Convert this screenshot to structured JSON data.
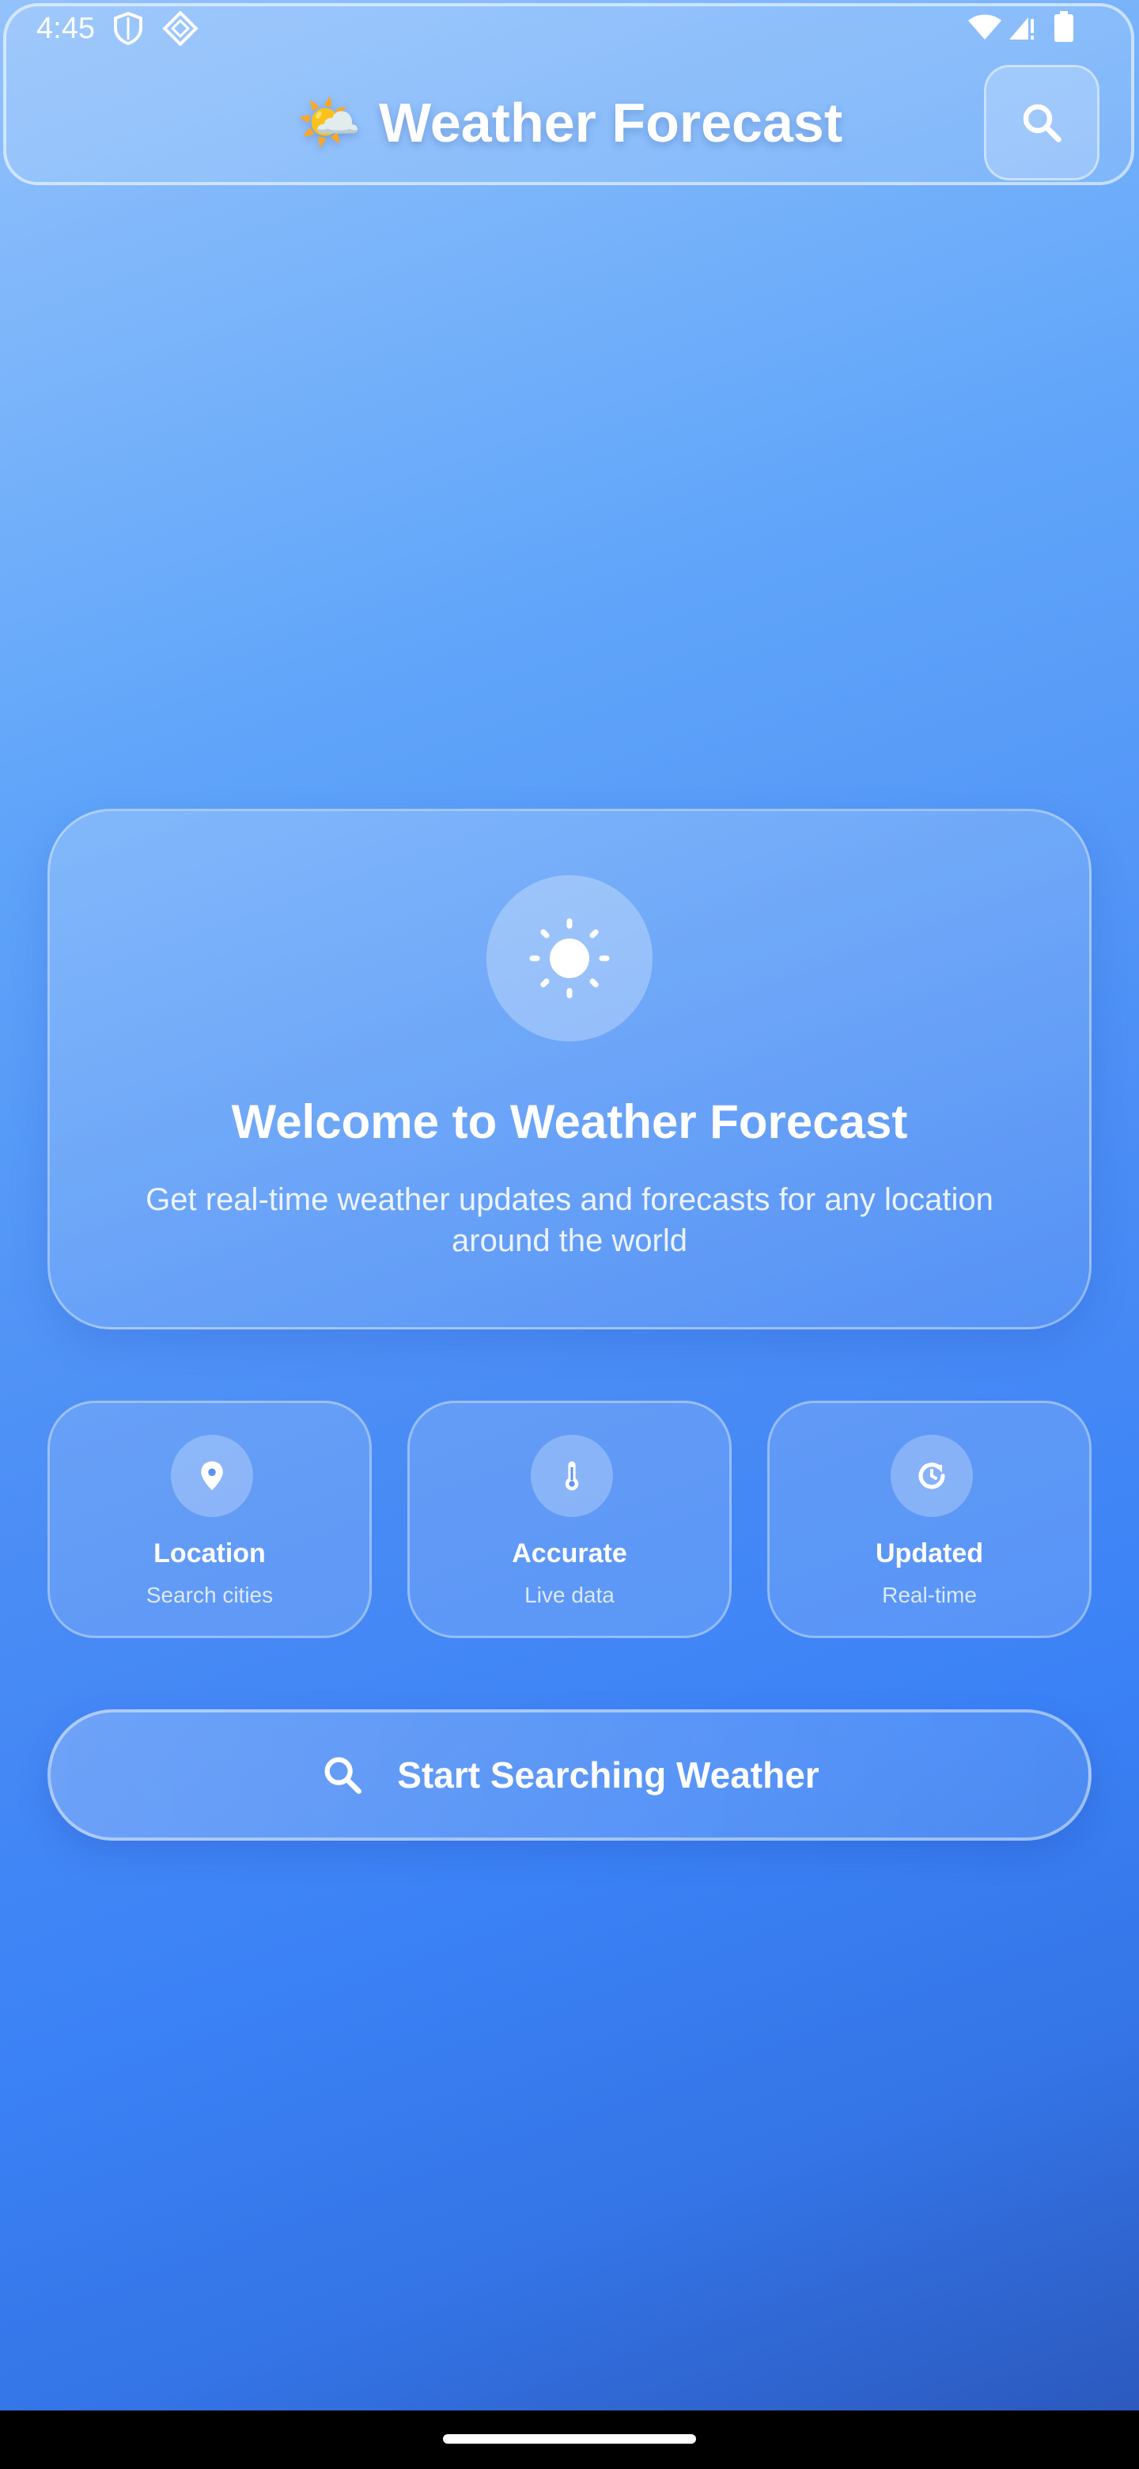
{
  "status_bar": {
    "time": "4:45"
  },
  "header": {
    "title_emoji": "🌤️",
    "title": "Weather Forecast"
  },
  "welcome": {
    "title": "Welcome to Weather Forecast",
    "subtitle": "Get real-time weather updates and forecasts for any location around the world"
  },
  "features": [
    {
      "icon": "location-pin-icon",
      "title": "Location",
      "subtitle": "Search cities"
    },
    {
      "icon": "thermometer-icon",
      "title": "Accurate",
      "subtitle": "Live data"
    },
    {
      "icon": "refresh-icon",
      "title": "Updated",
      "subtitle": "Real-time"
    }
  ],
  "cta": {
    "label": "Start Searching Weather"
  },
  "colors": {
    "background_top": "#93c2fb",
    "background_mid": "#3b82f6",
    "background_bottom": "#2a55b8",
    "text": "#ffffff"
  }
}
